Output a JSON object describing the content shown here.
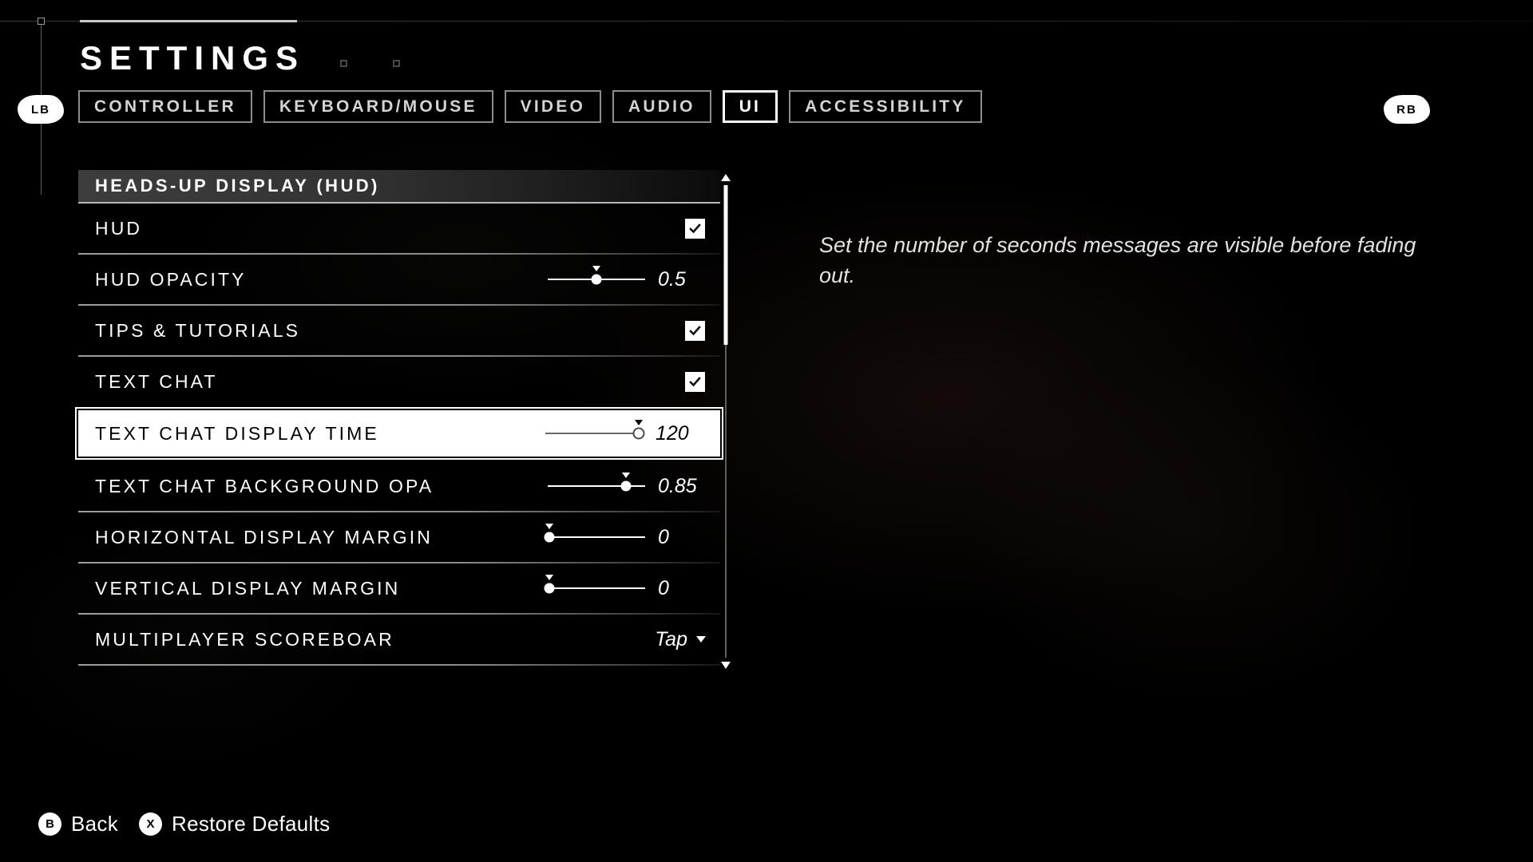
{
  "header": {
    "title": "SETTINGS",
    "left_bumper": "LB",
    "right_bumper": "RB"
  },
  "tabs": [
    {
      "label": "CONTROLLER",
      "selected": false
    },
    {
      "label": "KEYBOARD/MOUSE",
      "selected": false
    },
    {
      "label": "VIDEO",
      "selected": false
    },
    {
      "label": "AUDIO",
      "selected": false
    },
    {
      "label": "UI",
      "selected": true
    },
    {
      "label": "ACCESSIBILITY",
      "selected": false
    }
  ],
  "section": {
    "header": "HEADS-UP DISPLAY (HUD)"
  },
  "rows": [
    {
      "label": "HUD",
      "control": "checkbox",
      "checked": true
    },
    {
      "label": "HUD OPACITY",
      "control": "slider",
      "value": "0.5",
      "percent": 50
    },
    {
      "label": "TIPS & TUTORIALS",
      "control": "checkbox",
      "checked": true
    },
    {
      "label": "TEXT CHAT",
      "control": "checkbox",
      "checked": true
    },
    {
      "label": "TEXT CHAT DISPLAY TIME",
      "control": "slider",
      "value": "120",
      "percent": 96,
      "selected": true
    },
    {
      "label": "TEXT CHAT BACKGROUND OPA",
      "control": "slider",
      "value": "0.85",
      "percent": 80
    },
    {
      "label": "HORIZONTAL DISPLAY MARGIN",
      "control": "slider",
      "value": "0",
      "percent": 2
    },
    {
      "label": "VERTICAL DISPLAY MARGIN",
      "control": "slider",
      "value": "0",
      "percent": 2
    },
    {
      "label": "MULTIPLAYER SCOREBOAR",
      "control": "dropdown",
      "value": "Tap"
    }
  ],
  "description": "Set the number of seconds messages are visible before fading out.",
  "footer": [
    {
      "badge": "B",
      "label": "Back"
    },
    {
      "badge": "X",
      "label": "Restore Defaults"
    }
  ]
}
